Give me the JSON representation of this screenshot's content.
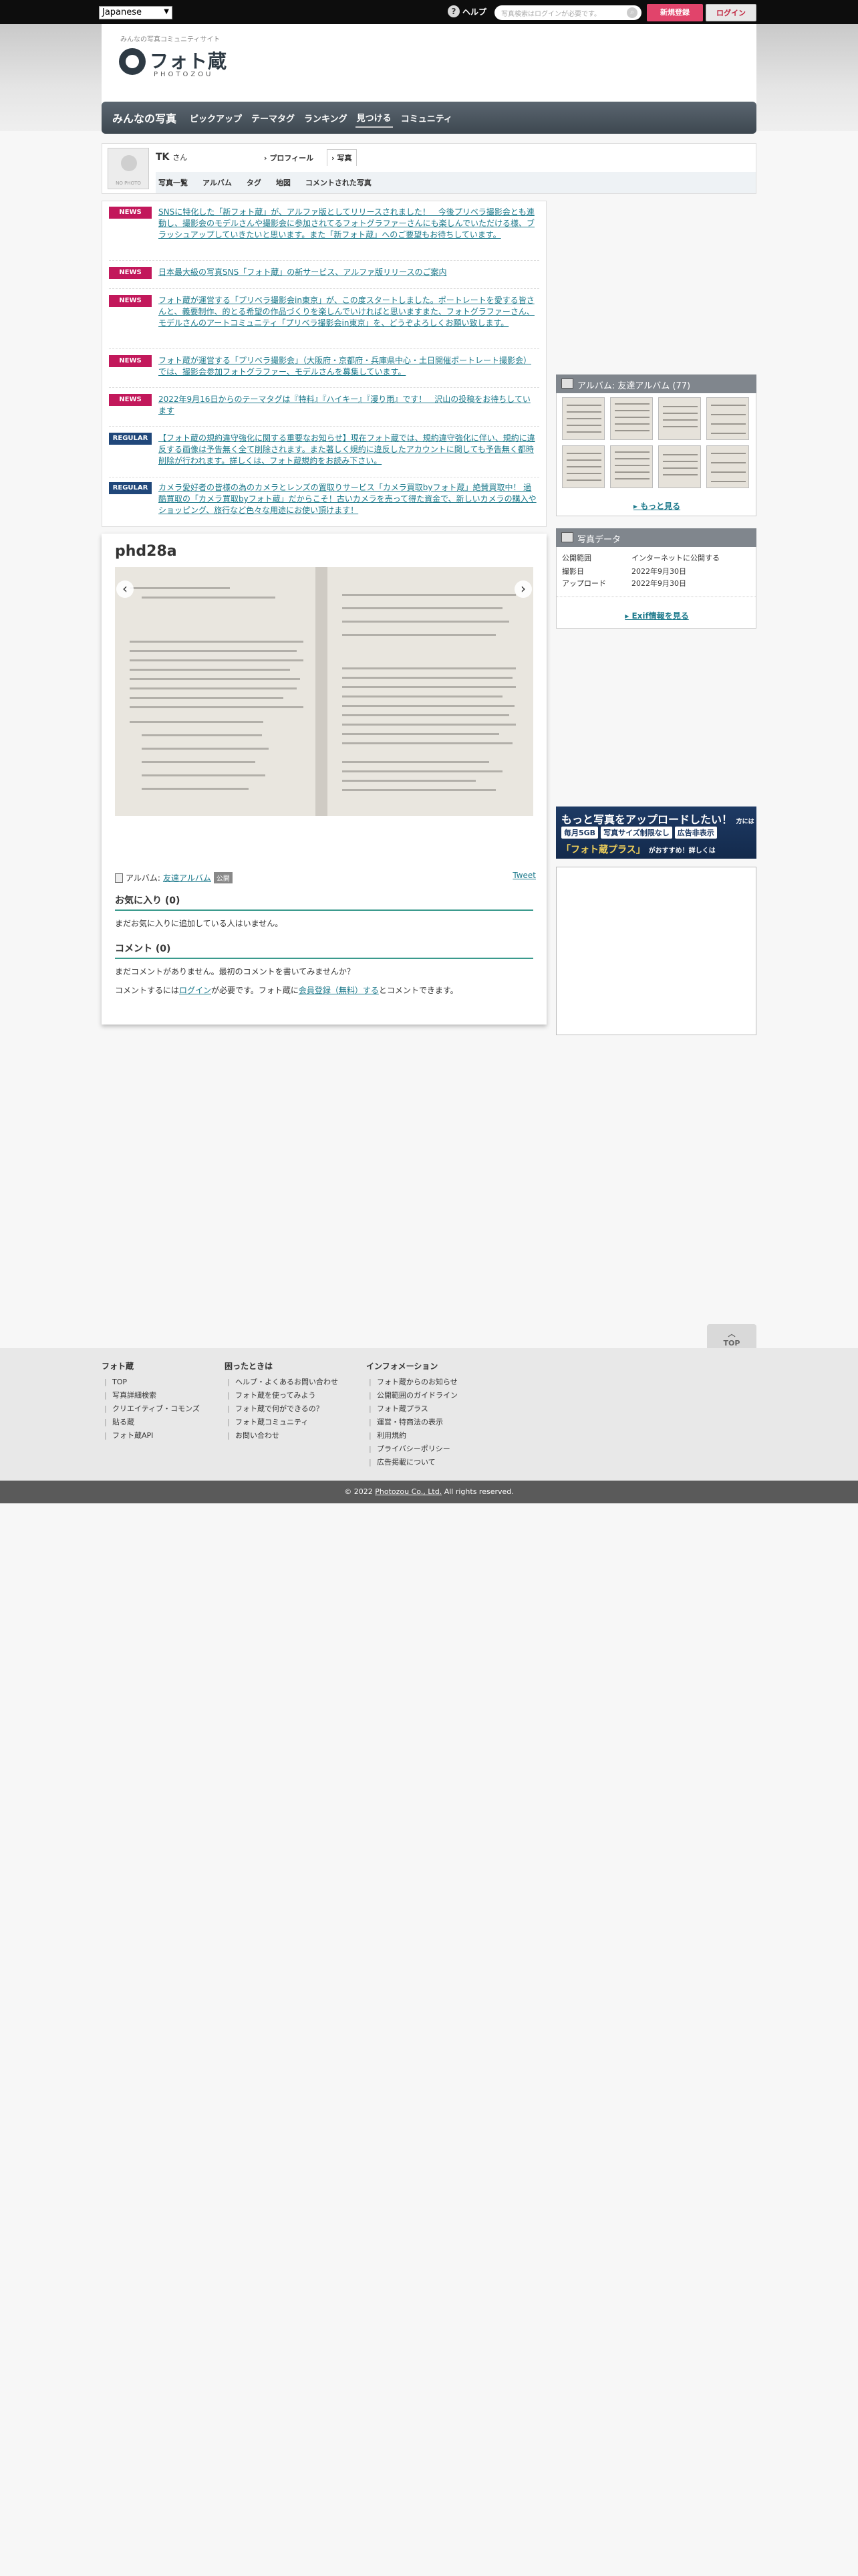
{
  "topbar": {
    "language": "Japanese",
    "help": "ヘルプ",
    "search_placeholder": "写真検索はログインが必要です。",
    "register": "新規登録",
    "login": "ログイン"
  },
  "header": {
    "tagline": "みんなの写真コミュニティサイト",
    "logo": "フォト蔵",
    "logo_sub": "PHOTOZOU",
    "nav": [
      "みんなの写真",
      "ピックアップ",
      "テーマタグ",
      "ランキング",
      "見つける",
      "コミュニティ"
    ]
  },
  "profile": {
    "avatar_text": "NO PHOTO",
    "name": "TK",
    "honorific": "さん",
    "tabs": [
      "プロフィール",
      "写真"
    ],
    "subtabs": [
      "写真一覧",
      "アルバム",
      "タグ",
      "地図",
      "コメントされた写真"
    ]
  },
  "news": [
    {
      "badge": "NEWS",
      "text": "SNSに特化した「新フォト蔵」が、アルファ版としてリリースされました！　今後プリベラ撮影会とも連動し、撮影会のモデルさんや撮影会に参加されてるフォトグラファーさんにも楽しんでいただける様、ブラッシュアップしていきたいと思います。また「新フォト蔵」へのご要望もお待ちしています。"
    },
    {
      "badge": "NEWS",
      "text": "日本最大級の写真SNS「フォト蔵」の新サービス、アルファ版リリースのご案内"
    },
    {
      "badge": "NEWS",
      "text": "フォト蔵が運営する「プリベラ撮影会in東京」が、この度スタートしました。ポートレートを愛する皆さんと、義要制作、的とる希望の作品づくりを楽しんでいければと思いますまた、フォトグラファーさん、モデルさんのアートコミュニティ「プリベラ撮影会in東京」を、どうぞよろしくお願い致します。"
    },
    {
      "badge": "NEWS",
      "text": "フォト蔵が運営する「プリベラ撮影会」（大阪府・京都府・兵庫県中心・土日開催ポートレート撮影会）では、撮影会参加フォトグラファー、モデルさんを募集しています。"
    },
    {
      "badge": "NEWS",
      "text": "2022年9月16日からのテーマタグは『特料』『ハイキー』『漫り雨』です！　沢山の投稿をお待ちしています"
    },
    {
      "badge": "REGULAR",
      "text": "【フォト蔵の規約違守強化に関する重要なお知らせ】現在フォト蔵では、規約違守強化に伴い、規約に違反する画像は予告無く全て削除されます。また著しく規約に違反したアカウントに関しても予告無く都時削除が行われます。詳しくは、フォト蔵規約をお読み下さい。"
    },
    {
      "badge": "REGULAR",
      "text": "カメラ愛好者の皆様の為のカメラとレンズの置取りサービス「カメラ買取byフォト蔵」絶賛買取中！ 過酷買取の「カメラ買取byフォト蔵」だからこそ！古いカメラを売って得た資金で、新しいカメラの購入やショッピング、旅行など色々な用途にお使い頂けます！"
    }
  ],
  "photo": {
    "title": "phd28a",
    "album_label": "アルバム:",
    "album_name": "友達アルバム",
    "privacy_tag": "公開",
    "tweet": "Tweet",
    "favorites_heading": "お気に入り (0)",
    "favorites_empty": "まだお気に入りに追加している人はいません。",
    "comments_heading": "コメント (0)",
    "comments_empty": "まだコメントがありません。最初のコメントを書いてみませんか？",
    "comment_prompt_1": "コメントするには",
    "comment_login": "ログイン",
    "comment_prompt_2": "が必要です。フォト蔵に",
    "comment_register": "会員登録（無料）する",
    "comment_prompt_3": "とコメントできます。"
  },
  "sidebar": {
    "album_title": "アルバム: 友達アルバム (77)",
    "more": "もっと見る",
    "data_title": "写真データ",
    "data_rows": [
      {
        "k": "公開範囲",
        "v": "インターネットに公開する"
      },
      {
        "k": "撮影日",
        "v": "2022年9月30日"
      },
      {
        "k": "アップロード",
        "v": "2022年9月30日"
      }
    ],
    "exif_link": "Exif情報を見る",
    "banner_l1": "もっと写真をアップロードしたい！",
    "banner_l1_small": "方には",
    "banner_l2": [
      "毎月5GB",
      "写真サイズ制限なし",
      "広告非表示"
    ],
    "banner_l3": "「フォト蔵プラス」",
    "banner_l3_small": "がおすすめ！詳しくは"
  },
  "footer": {
    "top_button": "TOP",
    "col1": {
      "heading": "フォト蔵",
      "items": [
        "TOP",
        "写真詳細検索",
        "クリエイティブ・コモンズ",
        "貼る蔵",
        "フォト蔵API"
      ]
    },
    "col2": {
      "heading": "困ったときは",
      "items": [
        "ヘルプ・よくあるお問い合わせ",
        "フォト蔵を使ってみよう",
        "フォト蔵で何ができるの？",
        "フォト蔵コミュニティ",
        "お問い合わせ"
      ]
    },
    "col3": {
      "heading": "インフォメーション",
      "items": [
        "フォト蔵からのお知らせ",
        "公開範囲のガイドライン",
        "フォト蔵プラス",
        "運営・特商法の表示",
        "利用規約",
        "プライバシーポリシー",
        "広告掲載について"
      ]
    },
    "copyright_pre": "© 2022 ",
    "copyright_link": "Photozou Co., Ltd.",
    "copyright_post": " All rights reserved."
  }
}
